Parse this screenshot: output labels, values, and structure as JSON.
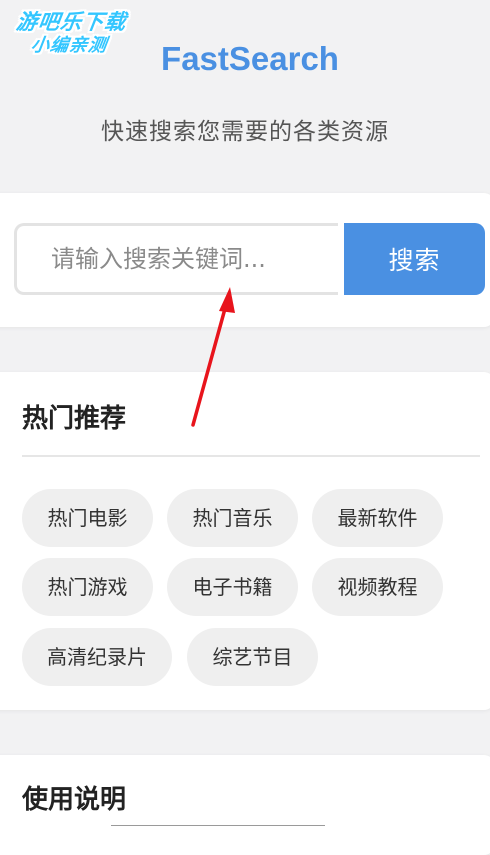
{
  "watermark": {
    "line1": "游吧乐下载",
    "line2": "小编亲测"
  },
  "header": {
    "title": "FastSearch",
    "subtitle": "快速搜索您需要的各类资源"
  },
  "search": {
    "placeholder": "请输入搜索关键词...",
    "value": "",
    "button_label": "搜索"
  },
  "hot": {
    "title": "热门推荐",
    "tags": [
      {
        "label": "热门电影"
      },
      {
        "label": "热门音乐"
      },
      {
        "label": "最新软件"
      },
      {
        "label": "热门游戏"
      },
      {
        "label": "电子书籍"
      },
      {
        "label": "视频教程"
      },
      {
        "label": "高清纪录片"
      },
      {
        "label": "综艺节目"
      }
    ]
  },
  "usage": {
    "title": "使用说明"
  },
  "colors": {
    "accent": "#4a90e2",
    "background": "#f2f2f3",
    "annotation": "#e8141c",
    "watermark": "#33c6ff"
  }
}
